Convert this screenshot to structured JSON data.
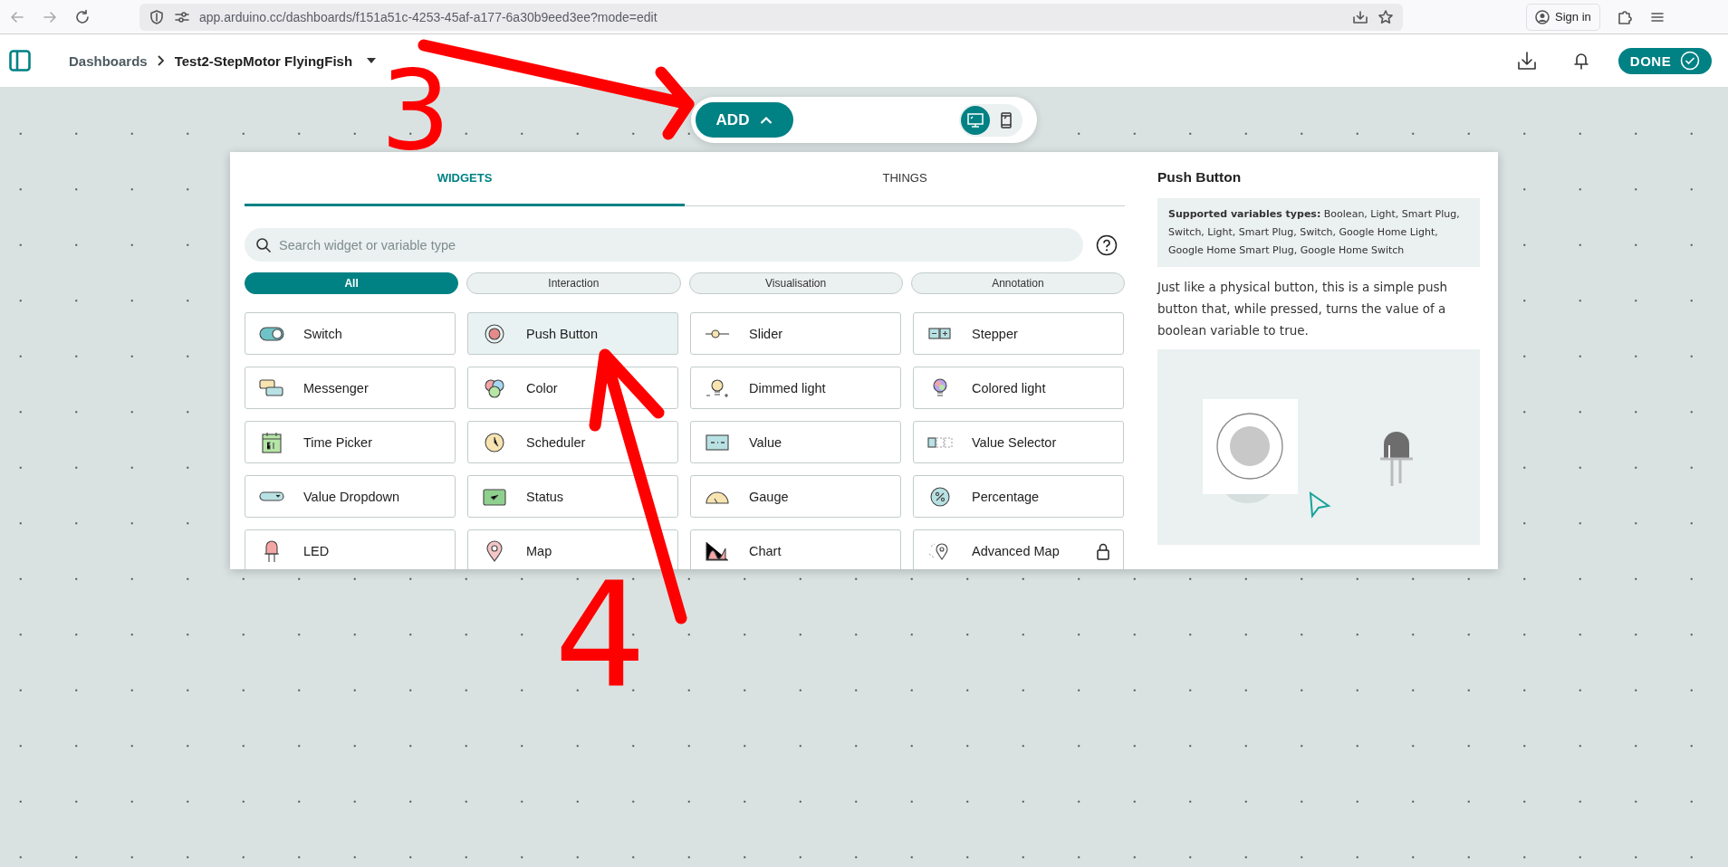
{
  "browser": {
    "url": "app.arduino.cc/dashboards/f151a51c-4253-45af-a177-6a30b9eed3ee?mode=edit",
    "sign_in": "Sign in"
  },
  "header": {
    "breadcrumb": "Dashboards",
    "title": "Test2-StepMotor FlyingFish",
    "done": "DONE"
  },
  "toolbar": {
    "add": "ADD",
    "view_modes": [
      {
        "kind": "desktop",
        "selected": true
      },
      {
        "kind": "mobile",
        "selected": false
      }
    ]
  },
  "tabs": [
    {
      "label": "WIDGETS",
      "selected": true
    },
    {
      "label": "THINGS",
      "selected": false
    }
  ],
  "search": {
    "placeholder": "Search widget or variable type"
  },
  "filters": [
    {
      "label": "All",
      "selected": true
    },
    {
      "label": "Interaction",
      "selected": false
    },
    {
      "label": "Visualisation",
      "selected": false
    },
    {
      "label": "Annotation",
      "selected": false
    }
  ],
  "widgets": [
    {
      "label": "Switch",
      "selected": false
    },
    {
      "label": "Push Button",
      "selected": true
    },
    {
      "label": "Slider",
      "selected": false
    },
    {
      "label": "Stepper",
      "selected": false
    },
    {
      "label": "Messenger",
      "selected": false
    },
    {
      "label": "Color",
      "selected": false
    },
    {
      "label": "Dimmed light",
      "selected": false
    },
    {
      "label": "Colored light",
      "selected": false
    },
    {
      "label": "Time Picker",
      "selected": false
    },
    {
      "label": "Scheduler",
      "selected": false
    },
    {
      "label": "Value",
      "selected": false
    },
    {
      "label": "Value Selector",
      "selected": false
    },
    {
      "label": "Value Dropdown",
      "selected": false
    },
    {
      "label": "Status",
      "selected": false
    },
    {
      "label": "Gauge",
      "selected": false
    },
    {
      "label": "Percentage",
      "selected": false
    },
    {
      "label": "LED",
      "selected": false
    },
    {
      "label": "Map",
      "selected": false
    },
    {
      "label": "Chart",
      "selected": false
    },
    {
      "label": "Advanced Map",
      "selected": false,
      "locked": true
    }
  ],
  "detail": {
    "title": "Push Button",
    "supported": "**Supported variables types:** Boolean, Light, Smart Plug, Switch, Light, Smart Plug, Switch, Google Home Light, Google Home Smart Plug, Google Home Switch",
    "description": "Just like a physical button, this is a simple push button that, while pressed, turns the value of a boolean variable to true."
  },
  "annotations": [
    {
      "label": "3"
    },
    {
      "label": "4"
    }
  ]
}
